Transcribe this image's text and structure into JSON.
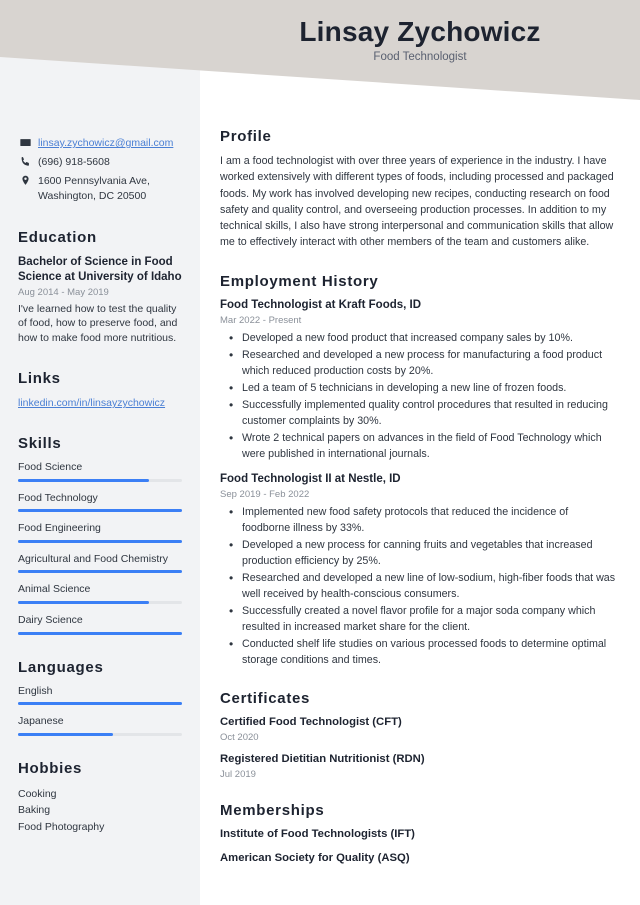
{
  "header": {
    "name": "Linsay Zychowicz",
    "job_title": "Food Technologist",
    "band_color": "#d8d4d0"
  },
  "sidebar": {
    "background_color": "#f2f3f5",
    "contact": [
      {
        "icon": "envelope-icon",
        "text": "linsay.zychowicz@gmail.com",
        "is_link": true
      },
      {
        "icon": "phone-icon",
        "text": "(696) 918-5608",
        "is_link": false
      },
      {
        "icon": "map-pin-icon",
        "text": "1600 Pennsylvania Ave, Washington, DC 20500",
        "is_link": false
      }
    ],
    "education": {
      "heading": "Education",
      "degree": "Bachelor of Science in Food Science at University of Idaho",
      "date": "Aug 2014 - May 2019",
      "description": "I've learned how to test the quality of food, how to preserve food, and how to make food more nutritious."
    },
    "links": {
      "heading": "Links",
      "items": [
        {
          "label": "linkedin.com/in/linsayzychowicz"
        }
      ]
    },
    "skills": {
      "heading": "Skills",
      "accent_color": "#3b7ff5",
      "track_color": "#e3e5e8",
      "items": [
        {
          "label": "Food Science",
          "level": 80
        },
        {
          "label": "Food Technology",
          "level": 100
        },
        {
          "label": "Food Engineering",
          "level": 100
        },
        {
          "label": "Agricultural and Food Chemistry",
          "level": 100
        },
        {
          "label": "Animal Science",
          "level": 80
        },
        {
          "label": "Dairy Science",
          "level": 100
        }
      ]
    },
    "languages": {
      "heading": "Languages",
      "items": [
        {
          "label": "English",
          "level": 100
        },
        {
          "label": "Japanese",
          "level": 58
        }
      ]
    },
    "hobbies": {
      "heading": "Hobbies",
      "items": [
        {
          "label": "Cooking"
        },
        {
          "label": "Baking"
        },
        {
          "label": "Food Photography"
        }
      ]
    }
  },
  "main": {
    "profile": {
      "heading": "Profile",
      "text": "I am a food technologist with over three years of experience in the industry. I have worked extensively with different types of foods, including processed and packaged foods. My work has involved developing new recipes, conducting research on food safety and quality control, and overseeing production processes. In addition to my technical skills, I also have strong interpersonal and communication skills that allow me to effectively interact with other members of the team and customers alike."
    },
    "employment": {
      "heading": "Employment History",
      "jobs": [
        {
          "title": "Food Technologist at Kraft Foods, ID",
          "date": "Mar 2022 - Present",
          "bullets": [
            "Developed a new food product that increased company sales by 10%.",
            "Researched and developed a new process for manufacturing a food product which reduced production costs by 20%.",
            "Led a team of 5 technicians in developing a new line of frozen foods.",
            "Successfully implemented quality control procedures that resulted in reducing customer complaints by 30%.",
            "Wrote 2 technical papers on advances in the field of Food Technology which were published in international journals."
          ]
        },
        {
          "title": "Food Technologist II at Nestle, ID",
          "date": "Sep 2019 - Feb 2022",
          "bullets": [
            "Implemented new food safety protocols that reduced the incidence of foodborne illness by 33%.",
            "Developed a new process for canning fruits and vegetables that increased production efficiency by 25%.",
            "Researched and developed a new line of low-sodium, high-fiber foods that was well received by health-conscious consumers.",
            "Successfully created a novel flavor profile for a major soda company which resulted in increased market share for the client.",
            "Conducted shelf life studies on various processed foods to determine optimal storage conditions and times."
          ]
        }
      ]
    },
    "certificates": {
      "heading": "Certificates",
      "items": [
        {
          "name": "Certified Food Technologist (CFT)",
          "date": "Oct 2020"
        },
        {
          "name": "Registered Dietitian Nutritionist (RDN)",
          "date": "Jul 2019"
        }
      ]
    },
    "memberships": {
      "heading": "Memberships",
      "items": [
        {
          "name": "Institute of Food Technologists (IFT)"
        },
        {
          "name": "American Society for Quality (ASQ)"
        }
      ]
    }
  }
}
